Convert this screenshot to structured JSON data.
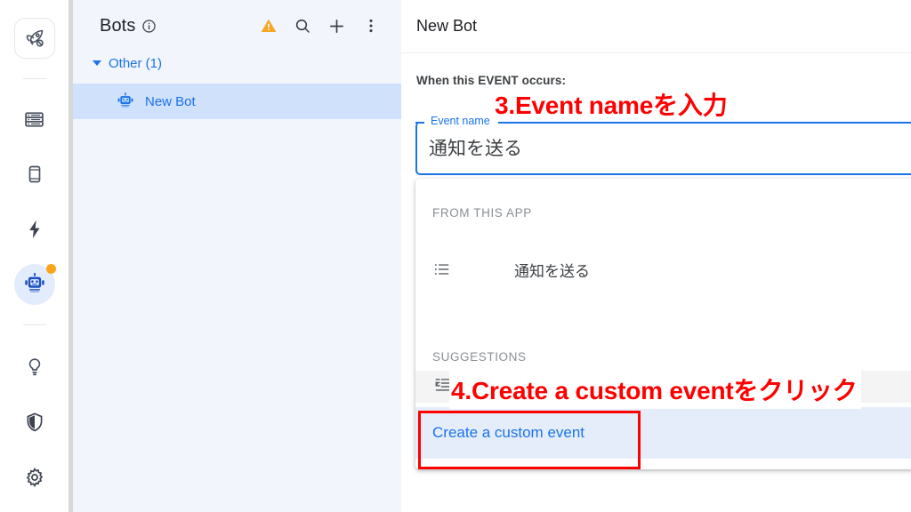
{
  "rail": {
    "items": [
      {
        "name": "rocket-icon",
        "label": "Launch",
        "active": false,
        "boxed": true,
        "badge": false
      },
      {
        "name": "database-icon",
        "label": "Data",
        "active": false,
        "boxed": false,
        "badge": false
      },
      {
        "name": "mobile-icon",
        "label": "Interface",
        "active": false,
        "boxed": false,
        "badge": false
      },
      {
        "name": "lightning-icon",
        "label": "Automations",
        "active": false,
        "boxed": false,
        "badge": false
      },
      {
        "name": "robot-icon",
        "label": "Bots",
        "active": true,
        "boxed": false,
        "badge": true
      },
      {
        "name": "lightbulb-icon",
        "label": "Insights",
        "active": false,
        "boxed": false,
        "badge": false
      },
      {
        "name": "shield-icon",
        "label": "Security",
        "active": false,
        "boxed": false,
        "badge": false
      },
      {
        "name": "gear-icon",
        "label": "Settings",
        "active": false,
        "boxed": false,
        "badge": false
      }
    ]
  },
  "bots_panel": {
    "title": "Bots",
    "info_icon": "info-icon",
    "actions": [
      {
        "name": "warning-icon",
        "label": "Warning"
      },
      {
        "name": "search-icon",
        "label": "Search"
      },
      {
        "name": "add-icon",
        "label": "Add bot"
      },
      {
        "name": "more-vert-icon",
        "label": "More options"
      }
    ],
    "group": {
      "label": "Other (1)",
      "expanded": true
    },
    "bot": {
      "label": "New Bot",
      "icon": "robot-icon",
      "selected": true
    }
  },
  "main": {
    "title": "New Bot",
    "when_label": "When this EVENT occurs:",
    "event_field": {
      "label": "Event name",
      "value": "通知を送る",
      "focused": true
    },
    "dropdown": {
      "section_from_app": "FROM THIS APP",
      "items_from_app": [
        {
          "icon": "list-icon",
          "label": "通知を送る"
        }
      ],
      "section_suggestions": "SUGGESTIONS",
      "hovered_item": {
        "icon": "format-indent-icon",
        "label": ""
      },
      "create_item": {
        "label": "Create a custom event",
        "highlighted": true
      }
    }
  },
  "annotations": [
    {
      "id": "step-3",
      "text": "3.Event nameを入力",
      "color": "#ff0000"
    },
    {
      "id": "step-4",
      "text": "4.Create a custom eventをクリック",
      "color": "#ff0000"
    }
  ],
  "colors": {
    "accent_blue": "#1a73e8",
    "panel_bg": "#f2f5fc",
    "selected_row": "#cfe1fb",
    "highlight_row": "#e6edfa",
    "annotation_red": "#ff0000",
    "warning_orange": "#f5a623",
    "badge_orange": "#fba41c"
  }
}
